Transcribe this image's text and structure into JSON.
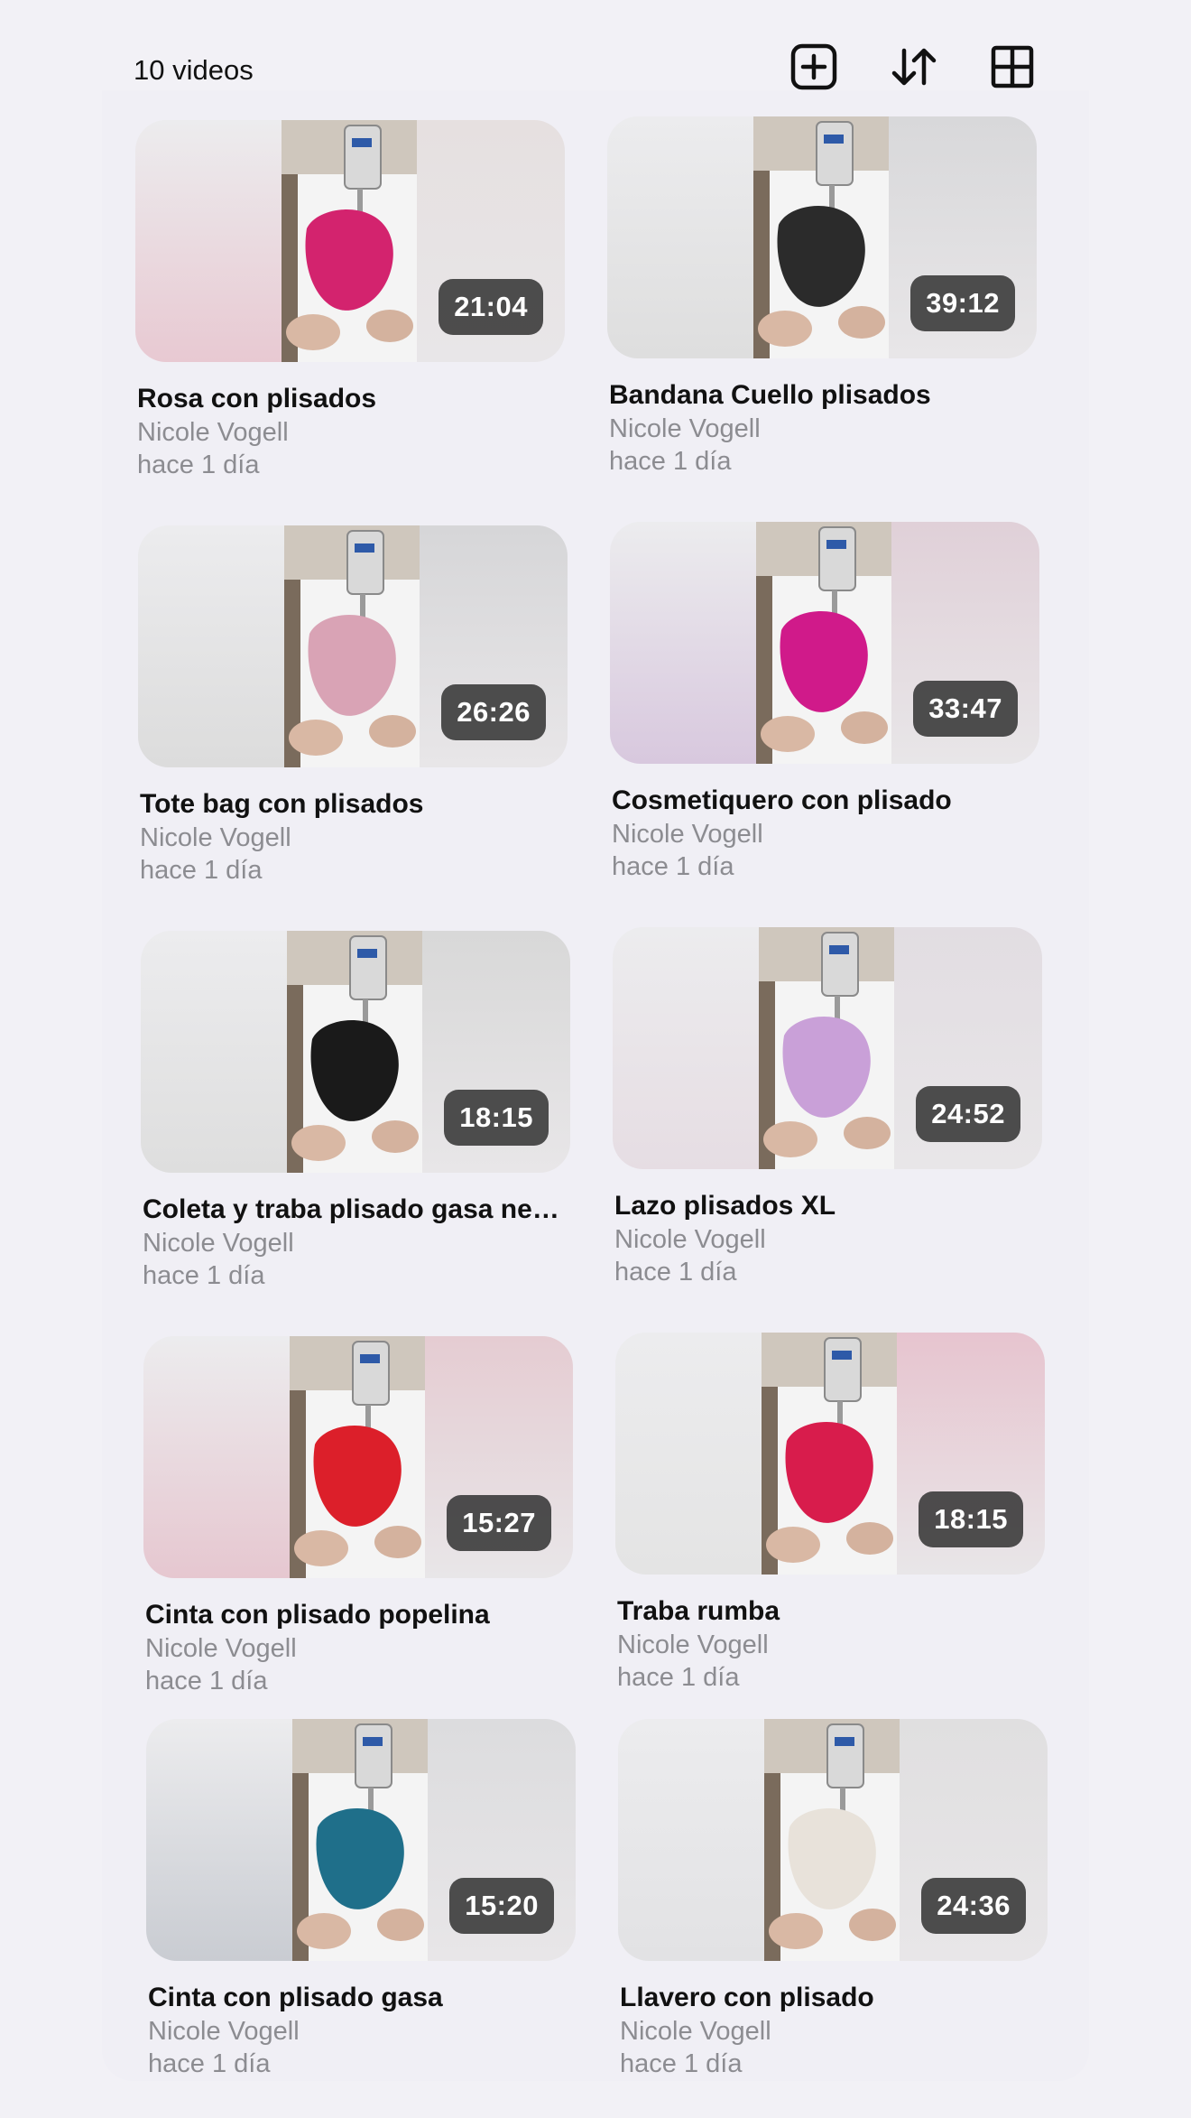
{
  "header": {
    "video_count": "10 videos",
    "icons": [
      "add-square-icon",
      "sort-arrows-icon",
      "grid-view-icon"
    ]
  },
  "videos": [
    {
      "title": "Rosa con plisados",
      "channel": "Nicole Vogell",
      "age": "hace 1 día",
      "duration": "21:04",
      "tint_left": "#e8c9d2",
      "tint_right": "#e6e0e0",
      "accent": "#d3236e"
    },
    {
      "title": "Bandana Cuello plisados",
      "channel": "Nicole Vogell",
      "age": "hace 1 día",
      "duration": "39:12",
      "tint_left": "#dedede",
      "tint_right": "#d8d8da",
      "accent": "#2b2b2b"
    },
    {
      "title": "Tote bag con plisados",
      "channel": "Nicole Vogell",
      "age": "hace 1 día",
      "duration": "26:26",
      "tint_left": "#dcdcdc",
      "tint_right": "#d6d6d8",
      "accent": "#d9a3b5"
    },
    {
      "title": "Cosmetiquero con plisado",
      "channel": "Nicole Vogell",
      "age": "hace 1 día",
      "duration": "33:47",
      "tint_left": "#d8c8de",
      "tint_right": "#e0d0d8",
      "accent": "#d01a8a"
    },
    {
      "title": "Coleta y traba plisado gasa negra",
      "channel": "Nicole Vogell",
      "age": "hace 1 día",
      "duration": "18:15",
      "tint_left": "#dedede",
      "tint_right": "#d8d8d8",
      "accent": "#1a1a1a"
    },
    {
      "title": "Lazo plisados XL",
      "channel": "Nicole Vogell",
      "age": "hace 1 día",
      "duration": "24:52",
      "tint_left": "#e6dde3",
      "tint_right": "#e2dde2",
      "accent": "#c9a0d8"
    },
    {
      "title": "Cinta con plisado popelina",
      "channel": "Nicole Vogell",
      "age": "hace 1 día",
      "duration": "15:27",
      "tint_left": "#e6c7d0",
      "tint_right": "#e5ccd2",
      "accent": "#dc1f2a"
    },
    {
      "title": "Traba rumba",
      "channel": "Nicole Vogell",
      "age": "hace 1 día",
      "duration": "18:15",
      "tint_left": "#e4e4e4",
      "tint_right": "#e7c4cf",
      "accent": "#d81c4c"
    },
    {
      "title": "Cinta con plisado gasa",
      "channel": "Nicole Vogell",
      "age": "hace 1 día",
      "duration": "15:20",
      "tint_left": "#c9ccd2",
      "tint_right": "#dcdcde",
      "accent": "#1f6f8a"
    },
    {
      "title": "Llavero con plisado",
      "channel": "Nicole Vogell",
      "age": "hace 1 día",
      "duration": "24:36",
      "tint_left": "#e2e2e4",
      "tint_right": "#e0dfe0",
      "accent": "#e8e2da"
    }
  ]
}
